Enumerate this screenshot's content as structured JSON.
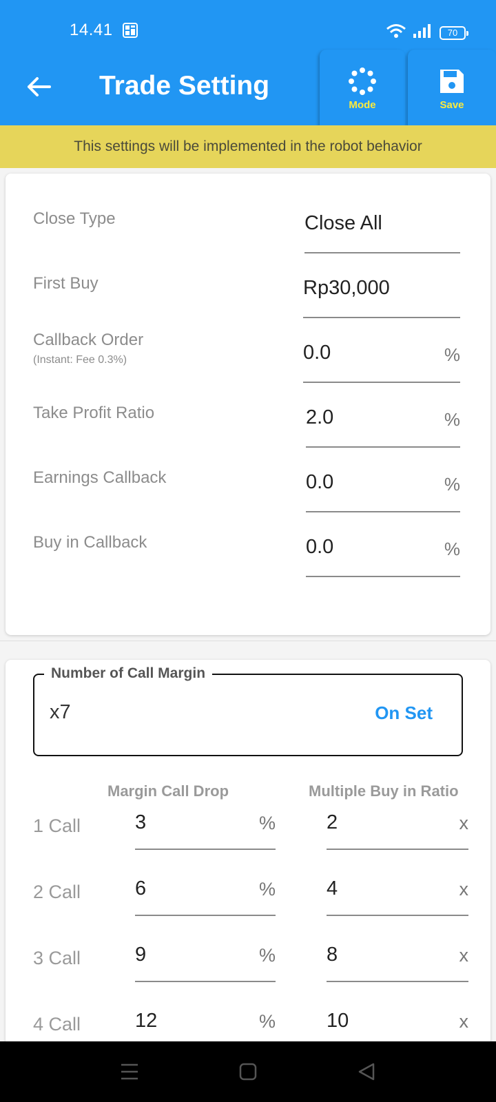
{
  "status_bar": {
    "time": "14.41",
    "battery": "70"
  },
  "app_bar": {
    "title": "Trade Setting",
    "mode_label": "Mode",
    "save_label": "Save"
  },
  "notice": "This settings will be implemented in the robot behavior",
  "settings": [
    {
      "label": "Close Type",
      "sublabel": "",
      "value": "Close All",
      "unit": ""
    },
    {
      "label": "First Buy",
      "sublabel": "",
      "value": "Rp30,000",
      "unit": ""
    },
    {
      "label": "Callback Order",
      "sublabel": "(Instant: Fee 0.3%)",
      "value": "0.0",
      "unit": "%"
    },
    {
      "label": "Take Profit Ratio",
      "sublabel": "",
      "value": "2.0",
      "unit": "%"
    },
    {
      "label": "Earnings Callback",
      "sublabel": "",
      "value": "0.0",
      "unit": "%"
    },
    {
      "label": "Buy in Callback",
      "sublabel": "",
      "value": "0.0",
      "unit": "%"
    }
  ],
  "call_margin": {
    "legend": "Number of Call Margin",
    "value": "x7",
    "button": "On Set",
    "col_drop": "Margin Call Drop",
    "col_ratio": "Multiple Buy in Ratio",
    "rows": [
      {
        "label": "1 Call",
        "drop": "3",
        "drop_unit": "%",
        "ratio": "2",
        "ratio_unit": "x"
      },
      {
        "label": "2 Call",
        "drop": "6",
        "drop_unit": "%",
        "ratio": "4",
        "ratio_unit": "x"
      },
      {
        "label": "3 Call",
        "drop": "9",
        "drop_unit": "%",
        "ratio": "8",
        "ratio_unit": "x"
      },
      {
        "label": "4 Call",
        "drop": "12",
        "drop_unit": "%",
        "ratio": "10",
        "ratio_unit": "x"
      }
    ]
  },
  "colors": {
    "primary": "#2196f3",
    "accent_yellow": "#ffeb3b",
    "notice_bg": "#e6d55a"
  }
}
